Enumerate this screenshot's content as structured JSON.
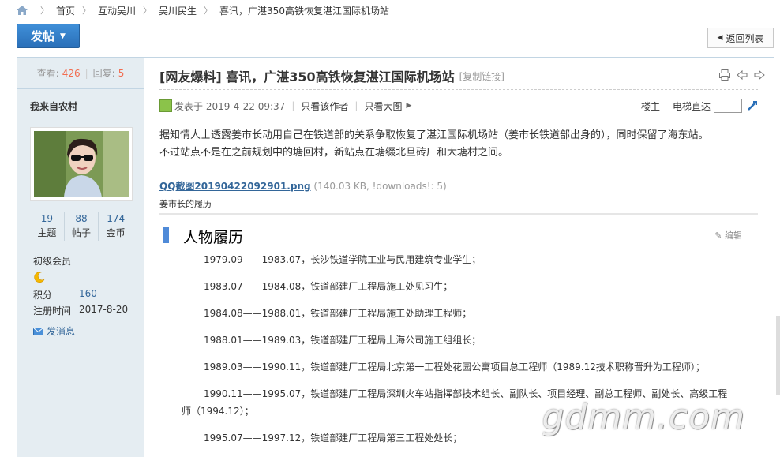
{
  "breadcrumb": {
    "items": [
      "首页",
      "互动吴川",
      "吴川民生",
      "喜讯，广湛350高铁恢复湛江国际机场站"
    ]
  },
  "toolbar": {
    "post_label": "发帖",
    "back_label": "返回列表"
  },
  "sidebar": {
    "views_label": "查看:",
    "views": "426",
    "replies_label": "回复:",
    "replies": "5",
    "author": "我来自农村",
    "stats": [
      {
        "value": "19",
        "label": "主题"
      },
      {
        "value": "88",
        "label": "帖子"
      },
      {
        "value": "174",
        "label": "金币"
      }
    ],
    "level": "初级会员",
    "points_label": "积分",
    "points": "160",
    "reg_label": "注册时间",
    "reg_date": "2017-8-20",
    "message_label": "发消息"
  },
  "post": {
    "title": "[网友爆料] 喜讯，广湛350高铁恢复湛江国际机场站",
    "copy_link": "[复制链接]",
    "posted_at": "发表于 2019-4-22 09:37",
    "only_author": "只看该作者",
    "only_images": "只看大图",
    "floor": "楼主",
    "jump_label": "电梯直达",
    "body_line1": "据知情人士透露姜市长动用自己在铁道部的关系争取恢复了湛江国际机场站（姜市长铁道部出身的），同时保留了海东站。",
    "body_line2": "不过站点不是在之前规划中的塘回村，新站点在塘缀北旦砖厂和大塘村之间。",
    "attachment_name": "QQ截图20190422092901.png",
    "attachment_info": "(140.03 KB, !downloads!: 5)",
    "caption": "姜市长的履历"
  },
  "embed": {
    "heading": "人物履历",
    "edit_label": "编辑",
    "rows": [
      "1979.09——1983.07，长沙铁道学院工业与民用建筑专业学生；",
      "1983.07——1984.08，铁道部建厂工程局施工处见习生；",
      "1984.08——1988.01，铁道部建厂工程局施工处助理工程师；",
      "1988.01——1989.03，铁道部建厂工程局上海公司施工组组长；",
      "1989.03——1990.11，铁道部建厂工程局北京第一工程处花园公寓项目总工程师（1989.12技术职称晋升为工程师）；",
      "1990.11——1995.07，铁道部建厂工程局深圳火车站指挥部技术组长、副队长、项目经理、副总工程师、副处长、高级工程",
      "师（1994.12）；",
      "1995.07——1997.12，铁道部建厂工程局第三工程处处长；"
    ],
    "watermark": "gdmm.com"
  },
  "colors": {
    "accent": "#2a6fb8",
    "link": "#336699",
    "count": "#f26c4f",
    "sidebar_bg": "#e5edf2"
  }
}
